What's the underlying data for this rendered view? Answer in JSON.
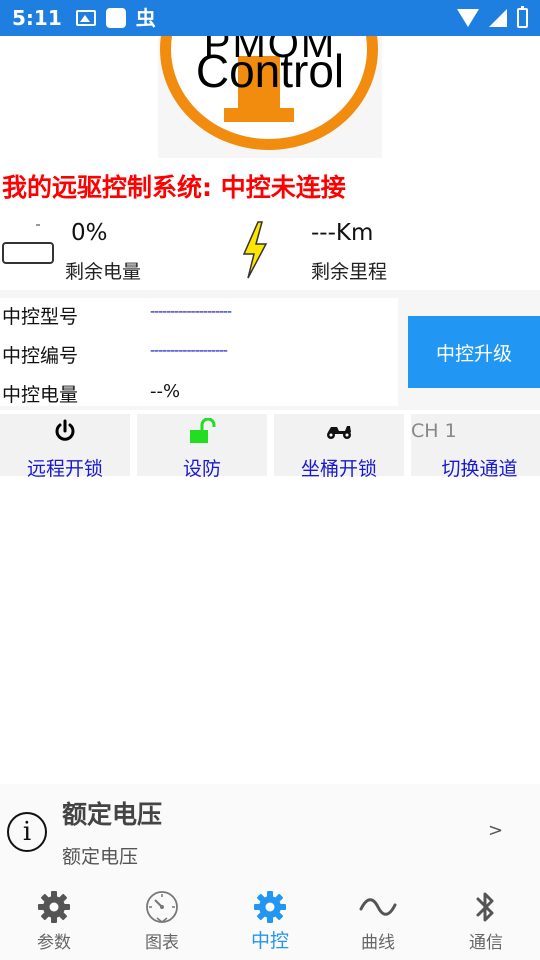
{
  "status_bar": {
    "time": "5:11",
    "bug_glyph": "虫",
    "icons": [
      "image-icon",
      "app-square-icon",
      "bug-icon",
      "wifi-icon",
      "signal-icon",
      "battery-icon"
    ]
  },
  "logo": {
    "top_text": "PMOM",
    "text": "Control"
  },
  "system_title": "我的远驱控制系统: 中控未连接",
  "battery": {
    "percent": "0%",
    "label": "剩余电量"
  },
  "mileage": {
    "value": "---Km",
    "label": "剩余里程"
  },
  "controller": {
    "model_label": "中控型号",
    "model_value": "--------------------",
    "serial_label": "中控编号",
    "serial_value": "-------------------",
    "power_label": "中控电量",
    "power_value": "--%",
    "upgrade_label": "中控升级"
  },
  "actions": {
    "remote_unlock": "远程开锁",
    "arm": "设防",
    "seat_unlock": "坐桶开锁",
    "channel_value": "CH 1",
    "switch_channel": "切换通道"
  },
  "rated_voltage": {
    "title": "额定电压",
    "subtitle": "额定电压",
    "chevron": ">",
    "info_glyph": "i"
  },
  "bottom_nav": {
    "params": "参数",
    "charts": "图表",
    "control": "中控",
    "curves": "曲线",
    "comms": "通信"
  },
  "colors": {
    "status_bar": "#1f7fe0",
    "accent": "#2196f3",
    "title_red": "#ff0000",
    "logo_orange": "#f18c0f",
    "link_blue": "#1a1ad0",
    "lock_green": "#22dd22",
    "bolt_yellow": "#ffe600"
  }
}
